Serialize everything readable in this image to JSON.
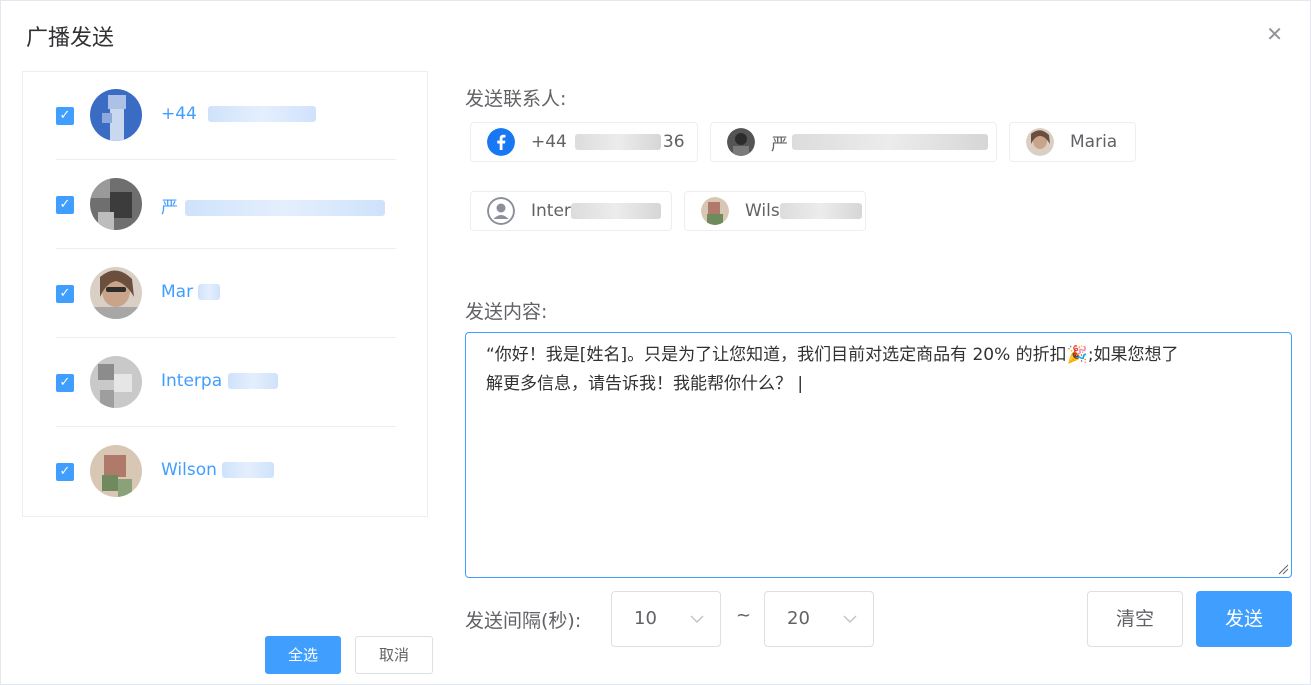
{
  "dialog": {
    "title": "广播发送",
    "close_icon": "close-icon"
  },
  "contacts": [
    {
      "name": "+44",
      "icon": "facebook-avatar",
      "checked": true
    },
    {
      "name": "严",
      "icon": "profile-photo-avatar",
      "checked": true
    },
    {
      "name": "Mar",
      "icon": "profile-photo-avatar",
      "checked": true
    },
    {
      "name": "Interpa",
      "icon": "profile-photo-avatar",
      "checked": true
    },
    {
      "name": "Wilson",
      "icon": "profile-photo-avatar",
      "checked": true
    }
  ],
  "left_actions": {
    "select_all": "全选",
    "cancel": "取消"
  },
  "recipients": {
    "label": "发送联系人:",
    "chips": [
      {
        "prefix": "+44",
        "suffix": "36",
        "icon": "facebook-icon"
      },
      {
        "prefix": "严",
        "suffix": "",
        "icon": "profile-photo-icon"
      },
      {
        "prefix": "Maria",
        "suffix": "",
        "icon": "profile-photo-icon"
      },
      {
        "prefix": "Inter",
        "suffix": "",
        "icon": "user-placeholder-icon"
      },
      {
        "prefix": "Wils",
        "suffix": "",
        "icon": "profile-photo-icon"
      }
    ]
  },
  "content": {
    "label": "发送内容:",
    "message_line1": "“你好！我是[姓名]。只是为了让您知道，我们目前对选定商品有 20% 的折扣🎉;如果您想了",
    "message_line2": "解更多信息，请告诉我！我能帮你什么？"
  },
  "interval": {
    "label": "发送间隔(秒):",
    "min_value": "10",
    "separator": "~",
    "max_value": "20"
  },
  "actions": {
    "clear": "清空",
    "send": "发送"
  },
  "colors": {
    "accent": "#409eff",
    "border": "#dcdfe6",
    "light_border": "#ebeef5"
  }
}
